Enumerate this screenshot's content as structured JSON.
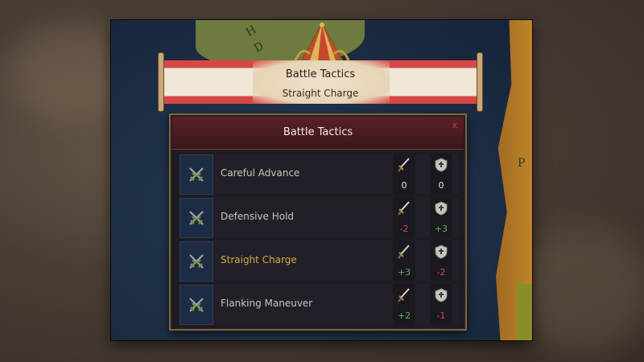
{
  "banner": {
    "title": "Battle Tactics",
    "subtitle": "Straight Charge"
  },
  "map": {
    "letters": [
      "H",
      "D",
      "P"
    ]
  },
  "panel": {
    "title": "Battle Tactics",
    "close_label": "x",
    "rows": [
      {
        "label": "Careful Advance",
        "attack": "0",
        "defense": "0",
        "attack_class": "zero",
        "defense_class": "zero",
        "selected": false
      },
      {
        "label": "Defensive Hold",
        "attack": "-2",
        "defense": "+3",
        "attack_class": "neg",
        "defense_class": "pos",
        "selected": false
      },
      {
        "label": "Straight Charge",
        "attack": "+3",
        "defense": "-2",
        "attack_class": "pos",
        "defense_class": "neg",
        "selected": true
      },
      {
        "label": "Flanking Maneuver",
        "attack": "+2",
        "defense": "-1",
        "attack_class": "pos",
        "defense_class": "neg",
        "selected": false
      }
    ]
  },
  "icons": {
    "row_icon": "crossed-swords-icon",
    "attack_icon": "sword-icon",
    "defense_icon": "shield-icon"
  },
  "colors": {
    "positive": "#5fb35a",
    "negative": "#d84a3e",
    "selected": "#d4a84a",
    "banner_red": "#d84747"
  }
}
